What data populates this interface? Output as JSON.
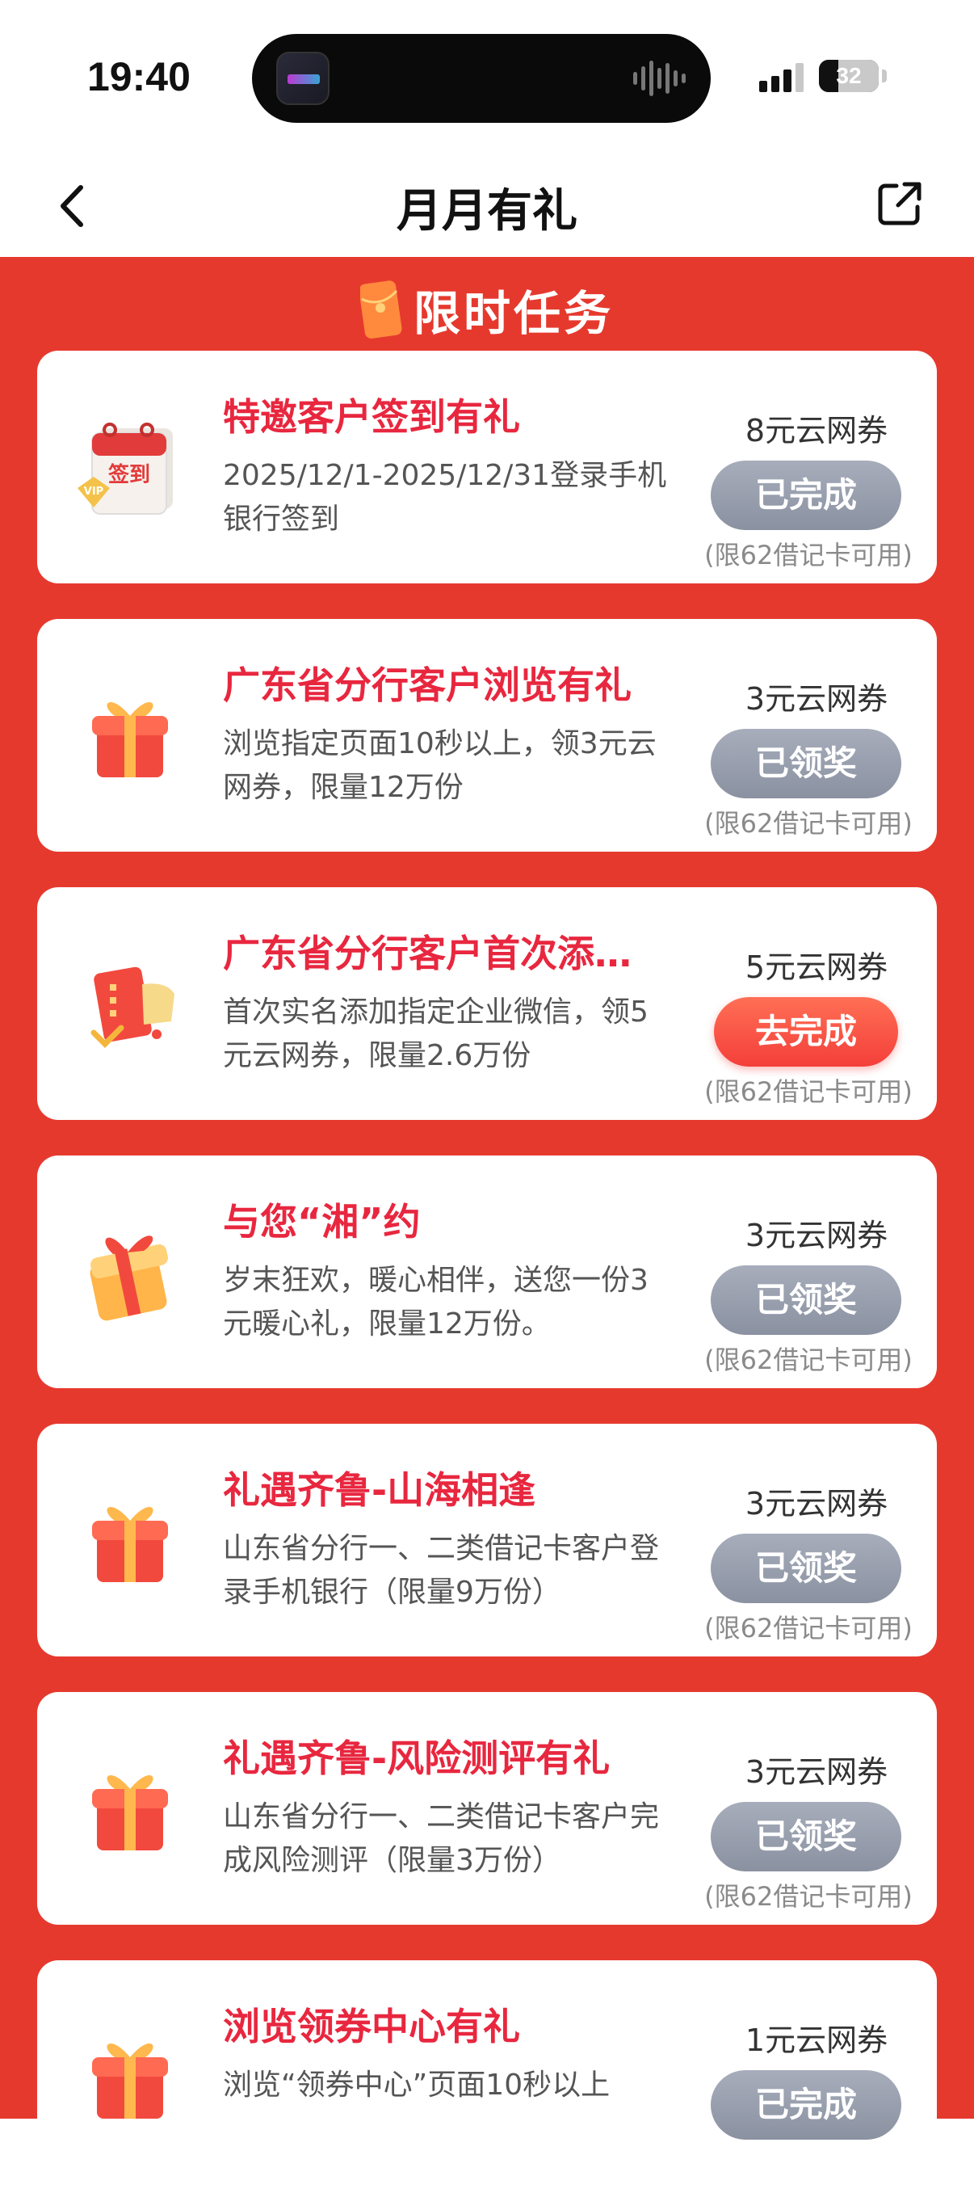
{
  "status_bar": {
    "time": "19:40",
    "battery": "32",
    "battery_level": 0.32
  },
  "nav": {
    "title": "月月有礼",
    "back_icon": "chevron-left-icon",
    "share_icon": "share-icon"
  },
  "section": {
    "title": "限时任务",
    "icon": "red-packet-icon"
  },
  "tasks": [
    {
      "title": "特邀客户签到有礼",
      "desc": "2025/12/1-2025/12/31登录手机银行签到",
      "reward": "8元云网券",
      "button": "已完成",
      "button_state": "done",
      "limit": "(限62借记卡可用)",
      "icon": "calendar-vip-icon",
      "icon_text": "签到"
    },
    {
      "title": "广东省分行客户浏览有礼",
      "desc": "浏览指定页面10秒以上，领3元云网券，限量12万份",
      "reward": "3元云网券",
      "button": "已领奖",
      "button_state": "done",
      "limit": "(限62借记卡可用)",
      "icon": "gift-box-icon"
    },
    {
      "title": "广东省分行客户首次添…",
      "desc": "首次实名添加指定企业微信，领5元云网券，限量2.6万份",
      "reward": "5元云网券",
      "button": "去完成",
      "button_state": "active",
      "limit": "(限62借记卡可用)",
      "icon": "card-document-icon"
    },
    {
      "title": "与您“湘”约",
      "desc": "岁末狂欢，暖心相伴，送您一份3元暖心礼，限量12万份。",
      "reward": "3元云网券",
      "button": "已领奖",
      "button_state": "done",
      "limit": "(限62借记卡可用)",
      "icon": "gift-box-gold-icon"
    },
    {
      "title": "礼遇齐鲁-山海相逢",
      "desc": "山东省分行一、二类借记卡客户登录手机银行（限量9万份）",
      "reward": "3元云网券",
      "button": "已领奖",
      "button_state": "done",
      "limit": "(限62借记卡可用)",
      "icon": "gift-box-icon"
    },
    {
      "title": "礼遇齐鲁-风险测评有礼",
      "desc": "山东省分行一、二类借记卡客户完成风险测评（限量3万份）",
      "reward": "3元云网券",
      "button": "已领奖",
      "button_state": "done",
      "limit": "(限62借记卡可用)",
      "icon": "gift-box-icon"
    },
    {
      "title": "浏览领券中心有礼",
      "desc": "浏览“领券中心”页面10秒以上",
      "reward": "1元云网券",
      "button": "已完成",
      "button_state": "done",
      "limit": "",
      "icon": "gift-box-icon"
    }
  ],
  "colors": {
    "background_red": "#e6392e",
    "title_red": "#e8273f",
    "button_gray": "#959cab",
    "button_red": "#f43f3a"
  }
}
